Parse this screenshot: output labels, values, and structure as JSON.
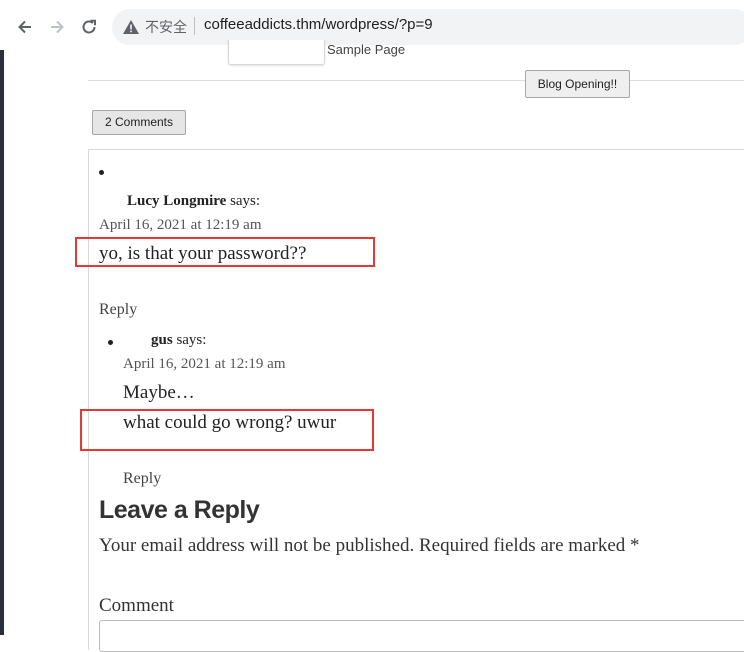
{
  "browser": {
    "insecure_label": "不安全",
    "url": "coffeeaddicts.thm/wordpress/?p=9",
    "back_icon": "arrow-left-icon",
    "forward_icon": "arrow-right-icon",
    "reload_icon": "reload-icon",
    "warning_icon": "warning-triangle-icon"
  },
  "nav": {
    "sample_page": "Sample Page",
    "blog_button": "Blog Opening!!"
  },
  "comments_button": "2 Comments",
  "comments": [
    {
      "author": "Lucy Longmire",
      "says": "says:",
      "date": "April 16, 2021 at 12:19 am",
      "lines": [
        "yo, is that your password??"
      ],
      "reply": "Reply"
    },
    {
      "author": "gus",
      "says": "says:",
      "date": "April 16, 2021 at 12:19 am",
      "lines": [
        "Maybe…",
        "what could go wrong? uwur"
      ],
      "reply": "Reply"
    }
  ],
  "reply_form": {
    "title": "Leave a Reply",
    "notes": "Your email address will not be published. Required fields are marked *",
    "comment_label": "Comment"
  },
  "colors": {
    "highlight": "#e53935"
  }
}
